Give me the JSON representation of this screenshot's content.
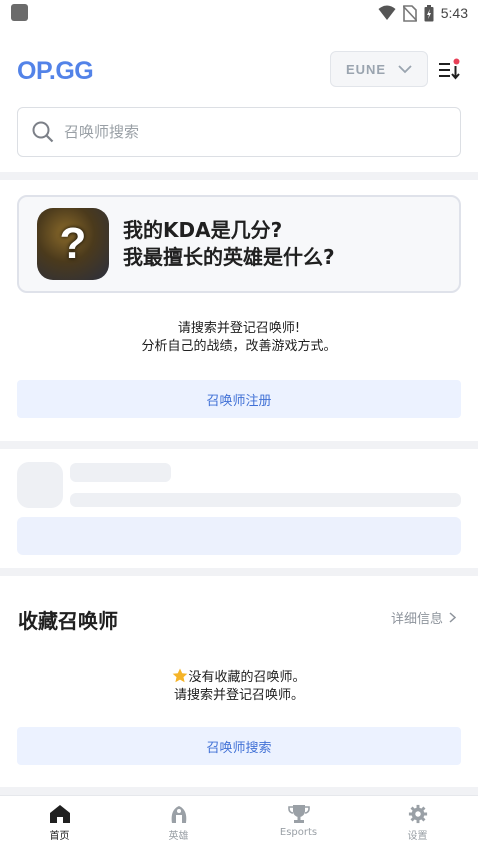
{
  "status_bar": {
    "time": "5:43"
  },
  "header": {
    "logo": "OP.GG",
    "region": "EUNE",
    "icons": {
      "region_dropdown": "chevron-down-icon",
      "sort": "sort-list-icon"
    },
    "accent_color": "#5383e8",
    "notification_dot_color": "#e84057"
  },
  "search": {
    "placeholder": "召唤师搜索",
    "value": "",
    "icon": "search-icon"
  },
  "promo": {
    "line1": "我的KDA是几分?",
    "line2": "我最擅长的英雄是什么?",
    "image_symbol": "?"
  },
  "register_section": {
    "line1": "请搜索并登记召唤师!",
    "line2": "分析自己的战绩，改善游戏方式。",
    "button_label": "召唤师注册"
  },
  "favorites": {
    "title": "收藏召唤师",
    "more_label": "详细信息",
    "empty_line1": "没有收藏的召唤师。",
    "empty_line2": "请搜索并登记召唤师。",
    "empty_icon": "star-icon",
    "button_label": "召唤师搜索"
  },
  "bottom_nav": {
    "items": [
      {
        "label": "首页",
        "icon": "home-icon",
        "active": true
      },
      {
        "label": "英雄",
        "icon": "champion-icon",
        "active": false
      },
      {
        "label": "Esports",
        "icon": "trophy-icon",
        "active": false
      },
      {
        "label": "设置",
        "icon": "gear-icon",
        "active": false
      }
    ]
  }
}
